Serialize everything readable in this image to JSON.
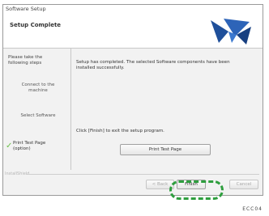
{
  "window": {
    "title": "Software Setup"
  },
  "header": {
    "title": "Setup Complete",
    "logo_icon": "setup-wizard-logo-icon"
  },
  "sidebar": {
    "intro": "Please take the following steps",
    "steps": [
      {
        "label": "Connect to the machine",
        "completed": false
      },
      {
        "label": "Select Software",
        "completed": false
      },
      {
        "label": "Print Test Page (option)",
        "completed": true
      }
    ]
  },
  "content": {
    "message": "Setup has completed. The selected Software components have been installed successfully.",
    "instruction": "Click [Finish] to exit the setup program.",
    "print_test_page_label": "Print Test Page"
  },
  "footer": {
    "installshield": "InstallShield",
    "back_label": "< Back",
    "finish_label": "Finish",
    "cancel_label": "Cancel"
  },
  "figure_code": "ECC04",
  "colors": {
    "check": "#6cc04a",
    "highlight": "#2e9e3e",
    "logo_blue": "#1f4f9a"
  }
}
